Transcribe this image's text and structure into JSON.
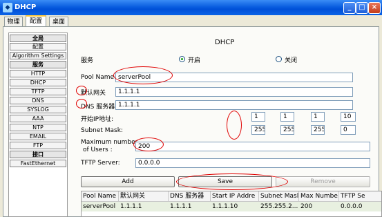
{
  "window": {
    "title": "DHCP",
    "icon": "packet-tracer-icon"
  },
  "tabs": [
    {
      "label": "物理"
    },
    {
      "label": "配置"
    },
    {
      "label": "桌面"
    }
  ],
  "nav": {
    "items": [
      {
        "label": "全局",
        "header": true
      },
      {
        "label": "配置",
        "header": false
      },
      {
        "label": "Algorithm Settings",
        "header": false
      },
      {
        "label": "服务",
        "header": true
      },
      {
        "label": "HTTP",
        "header": false
      },
      {
        "label": "DHCP",
        "header": false
      },
      {
        "label": "TFTP",
        "header": false
      },
      {
        "label": "DNS",
        "header": false
      },
      {
        "label": "SYSLOG",
        "header": false
      },
      {
        "label": "AAA",
        "header": false
      },
      {
        "label": "NTP",
        "header": false
      },
      {
        "label": "EMAIL",
        "header": false
      },
      {
        "label": "FTP",
        "header": false
      },
      {
        "label": "接口",
        "header": true
      },
      {
        "label": "FastEthernet",
        "header": false
      }
    ]
  },
  "dhcp": {
    "title": "DHCP",
    "service_label": "服务",
    "on_label": "开启",
    "off_label": "关闭",
    "service_on": true,
    "pool_name_label": "Pool Name",
    "pool_name_value": "serverPool",
    "gateway_label": "默认网关",
    "gateway_value": "1.1.1.1",
    "dns_label": "DNS 服务器",
    "dns_value": "1.1.1.1",
    "start_ip_label": "开始IP地址:",
    "start_ip": [
      "1",
      "1",
      "1",
      "10"
    ],
    "subnet_label": "Subnet Mask:",
    "subnet": [
      "255",
      "255",
      "255",
      "0"
    ],
    "max_users_label_1": "Maximum number",
    "max_users_label_2": "of Users :",
    "max_users_value": "200",
    "tftp_label": "TFTP Server:",
    "tftp_value": "0.0.0.0",
    "add_label": "Add",
    "save_label": "Save",
    "remove_label": "Remove"
  },
  "table": {
    "headers": [
      "Pool Name",
      "默认网关",
      "DNS 服务器",
      "Start IP Addre",
      "Subnet Masl",
      "Max Numbe",
      "TFTP Se"
    ],
    "rows": [
      [
        "serverPool",
        "1.1.1.1",
        "1.1.1.1",
        "1.1.1.10",
        "255.255.2...",
        "200",
        "0.0.0.0"
      ]
    ]
  }
}
